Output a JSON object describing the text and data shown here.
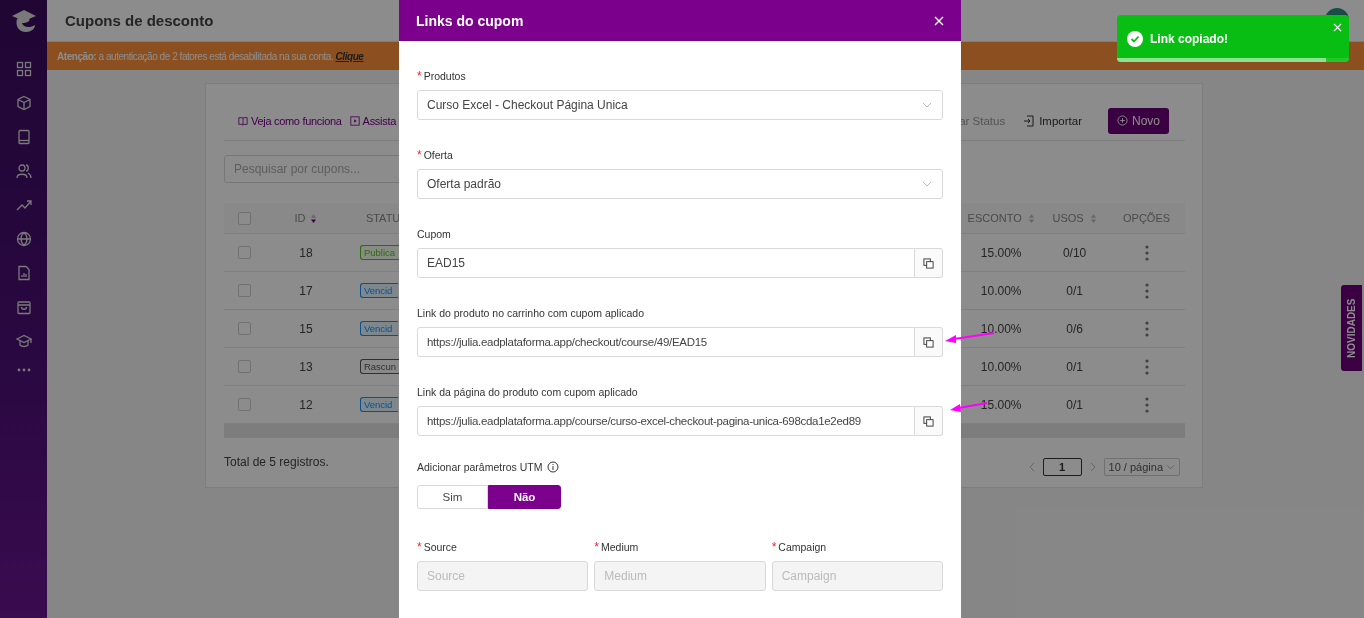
{
  "page": {
    "title": "Cupons de desconto"
  },
  "banner": {
    "label": "Atenção:",
    "text": "a autenticação de 2 fatores está desabilitada na sua conta.",
    "link": "Clique"
  },
  "toolbar": {
    "links": [
      "Veja como funciona",
      "Assista"
    ],
    "actions": [
      "ar Status",
      "Importar"
    ],
    "new_button": "Novo"
  },
  "search": {
    "placeholder": "Pesquisar por cupons..."
  },
  "table": {
    "all_checked": false,
    "columns": [
      {
        "label": "ID",
        "sortable": true
      },
      {
        "label": "STATU",
        "sortable": false
      },
      {
        "label": "ESCONTO",
        "sortable": true
      },
      {
        "label": "USOS",
        "sortable": true
      },
      {
        "label": "OPÇÕES",
        "sortable": false
      }
    ],
    "rows": [
      {
        "checked": false,
        "id": "18",
        "status": "Publica",
        "kind": "published",
        "discount": "15.00%",
        "uses": "0/10"
      },
      {
        "checked": false,
        "id": "17",
        "status": "Vencid",
        "kind": "expired",
        "discount": "10.00%",
        "uses": "0/1"
      },
      {
        "checked": false,
        "id": "15",
        "status": "Vencid",
        "kind": "expired",
        "discount": "10.00%",
        "uses": "0/6"
      },
      {
        "checked": false,
        "id": "13",
        "status": "Rascun",
        "kind": "draft",
        "discount": "10.00%",
        "uses": "0/1"
      },
      {
        "checked": false,
        "id": "12",
        "status": "Vencid",
        "kind": "expired",
        "discount": "15.00%",
        "uses": "0/1"
      }
    ]
  },
  "footer": {
    "total": "Total de 5 registros.",
    "page": "1",
    "page_size": "10 / página"
  },
  "side_tab": "NOVIDADES",
  "modal": {
    "title": "Links do cupom",
    "fields": [
      {
        "kind": "select",
        "mark": "*",
        "label": "Produtos",
        "value": "Curso Excel - Checkout Página Unica"
      },
      {
        "kind": "select",
        "mark": "*",
        "label": "Oferta",
        "value": "Oferta padrão"
      },
      {
        "kind": "copy",
        "label": "Cupom",
        "value": "EAD15"
      },
      {
        "kind": "copy",
        "label": "Link do produto no carrinho com cupom aplicado",
        "value": "https://julia.eadplataforma.app/checkout/course/49/EAD15"
      },
      {
        "kind": "copy",
        "label": "Link da página do produto com cupom aplicado",
        "value": "https://julia.eadplataforma.app/course/curso-excel-checkout-pagina-unica-698cda1e2ed89"
      }
    ],
    "utm": {
      "label": "Adicionar parâmetros UTM",
      "options": [
        {
          "label": "Sim",
          "selected": false
        },
        {
          "label": "Não",
          "selected": true
        }
      ]
    },
    "utm_fields": [
      {
        "mark": "*",
        "label": "Source",
        "placeholder": "Source"
      },
      {
        "mark": "*",
        "label": "Medium",
        "placeholder": "Medium"
      },
      {
        "mark": "*",
        "label": "Campaign",
        "placeholder": "Campaign"
      }
    ]
  },
  "toast": {
    "message": "Link copiado!",
    "level": 0.9
  }
}
